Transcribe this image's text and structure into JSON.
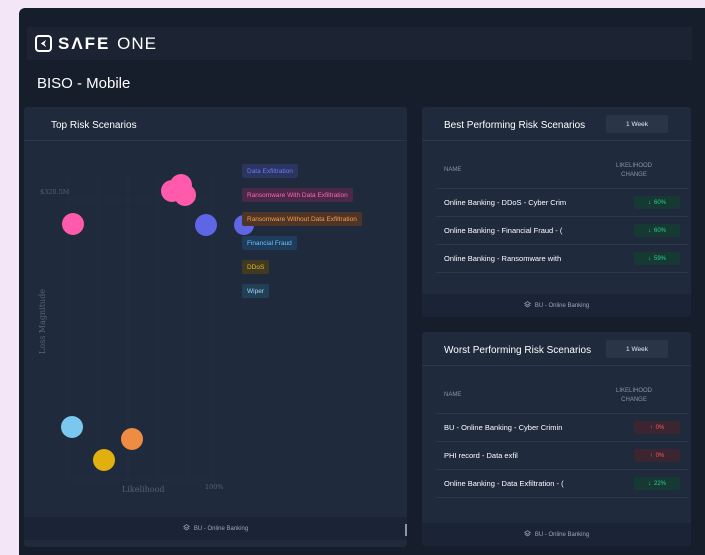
{
  "app": {
    "logo_bold": "SΛFE",
    "logo_light": "ONE",
    "page_title": "BISO - Mobile"
  },
  "colors": {
    "background": "#161d2b",
    "panel": "#1f2a3d",
    "increase": "#ff5a6a",
    "decrease": "#2ad08c"
  },
  "top_risk": {
    "title": "Top Risk Scenarios",
    "footer": "BU - Online Banking",
    "y_tick": "$320.5M",
    "x_tick": "100%",
    "x_label": "Likelihood",
    "y_label": "Loss Magnitude",
    "legend": [
      {
        "label": "Data Exfiltration",
        "color": "#6b78ff",
        "bg": "#2c3560"
      },
      {
        "label": "Ransomware With Data Exfiltration",
        "color": "#ff66b3",
        "bg": "#4a2848"
      },
      {
        "label": "Ransomware Without Data Exfiltration",
        "color": "#ff9a45",
        "bg": "#4d3528"
      },
      {
        "label": "Financial Fraud",
        "color": "#66c2ff",
        "bg": "#1f3d5a"
      },
      {
        "label": "DDoS",
        "color": "#e5b92a",
        "bg": "#3f3a20"
      },
      {
        "label": "Wiper",
        "color": "#9ad8ff",
        "bg": "#233f55"
      }
    ]
  },
  "best": {
    "title": "Best Performing Risk Scenarios",
    "period": "1 Week",
    "col_name": "NAME",
    "col_change": "LIKELIHOOD CHANGE",
    "rows": [
      {
        "name": "Online Banking - DDoS - Cyber Crim",
        "arrow": "↓",
        "value": "60%"
      },
      {
        "name": "Online Banking - Financial Fraud - (",
        "arrow": "↓",
        "value": "60%"
      },
      {
        "name": "Online Banking - Ransomware with",
        "arrow": "↓",
        "value": "59%"
      }
    ],
    "footer": "BU - Online Banking"
  },
  "worst": {
    "title": "Worst Performing Risk Scenarios",
    "period": "1 Week",
    "col_name": "NAME",
    "col_change": "LIKELIHOOD CHANGE",
    "rows": [
      {
        "name": "BU - Online Banking - Cyber Crimin",
        "arrow": "↑",
        "value": "0%"
      },
      {
        "name": "PHI record - Data exfil",
        "arrow": "↑",
        "value": "0%"
      },
      {
        "name": "Online Banking - Data Exfiltration - (",
        "arrow": "↓",
        "value": "22%"
      }
    ],
    "footer": "BU - Online Banking"
  }
}
